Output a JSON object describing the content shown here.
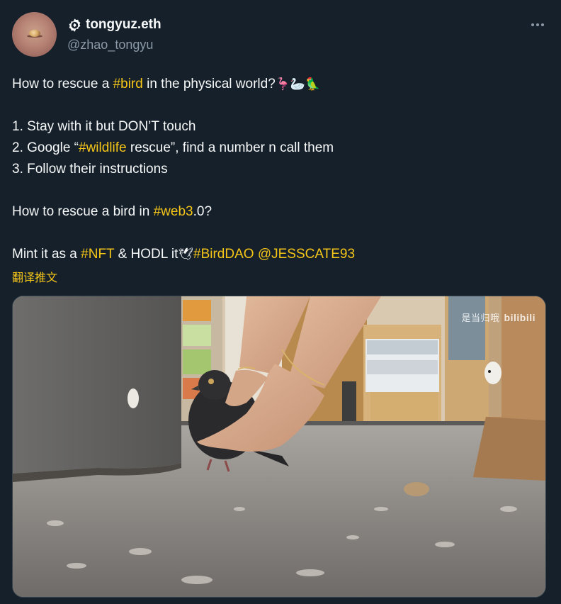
{
  "author": {
    "display_name": "tongyuz.eth",
    "handle": "@zhao_tongyu",
    "avatar_icon": "avatar-image",
    "verified_icon": "verified-badge-icon"
  },
  "menu": {
    "more_icon": "more-icon"
  },
  "tweet": {
    "line1": {
      "pre": "How to rescue a ",
      "tag": "#bird",
      "post": " in the physical world?",
      "emoji": "🦩🦢🦜"
    },
    "line2": "1. Stay with it but DON’T touch",
    "line3": {
      "pre": "2. Google “",
      "tag": "#wildlife",
      "post": " rescue”, find a number n call them"
    },
    "line4": "3. Follow their instructions",
    "line5": {
      "pre": "How to rescue a bird in ",
      "tag": "#web3",
      "post": ".0?"
    },
    "line6": {
      "pre": "Mint it as a ",
      "tag1": "#NFT",
      "mid": " & HODL it",
      "emoji": "🕊",
      "tag2": "#BirdDAO",
      "space": " ",
      "mention": "@JESSCATE93"
    }
  },
  "translate_label": "翻译推文",
  "media": {
    "watermark_cn": "是当归哦",
    "watermark_logo": "bilibili"
  },
  "colors": {
    "background": "#15202b",
    "text": "#f7f9f9",
    "secondary": "#8b98a5",
    "accent": "#f5c518"
  }
}
